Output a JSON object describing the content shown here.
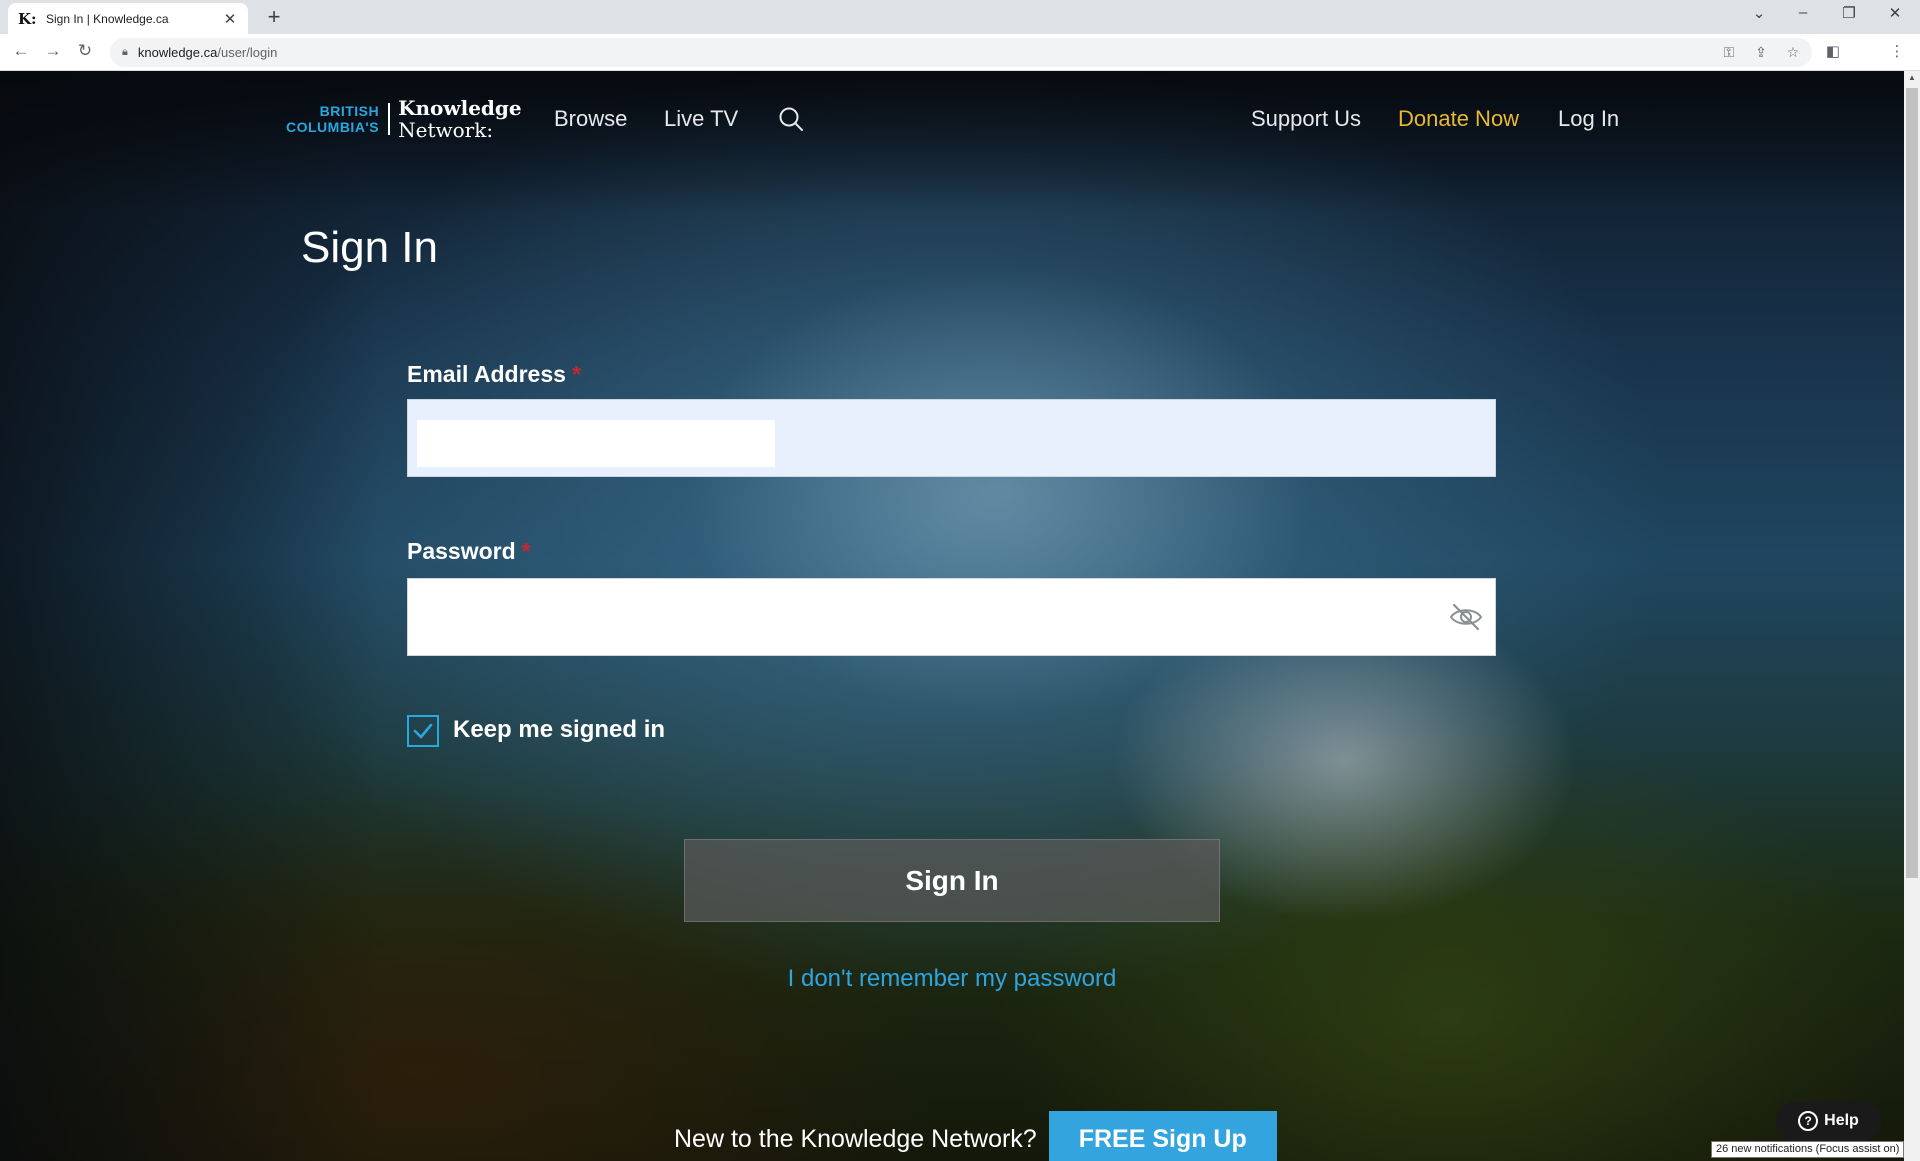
{
  "browser": {
    "tab_favicon": "K:",
    "tab_title": "Sign In | Knowledge.ca",
    "tab_close": "✕",
    "new_tab": "+",
    "url_host": "knowledge.ca",
    "url_path": "/user/login"
  },
  "site": {
    "logo": {
      "line1": "BRITISH",
      "line2": "COLUMBIA'S",
      "name1": "Knowledge",
      "name2": "Network:"
    },
    "nav": {
      "browse": "Browse",
      "live_tv": "Live TV",
      "support": "Support Us",
      "donate": "Donate Now",
      "login": "Log In"
    }
  },
  "form": {
    "title": "Sign In",
    "email_label": "Email Address",
    "password_label": "Password",
    "required_mark": "*",
    "email_value": "",
    "password_value": "",
    "keep_signed_in": "Keep me signed in",
    "keep_signed_in_checked": true,
    "submit": "Sign In",
    "forgot": "I don't remember my password",
    "signup_prompt": "New to the Knowledge Network?",
    "signup_button": "FREE Sign Up"
  },
  "help": {
    "label": "Help",
    "icon": "?"
  },
  "os": {
    "notification": "26 new notifications (Focus assist on)"
  },
  "colors": {
    "accent_blue": "#29a8e0",
    "donate_gold": "#e9b92f",
    "required_red": "#c8262b"
  }
}
